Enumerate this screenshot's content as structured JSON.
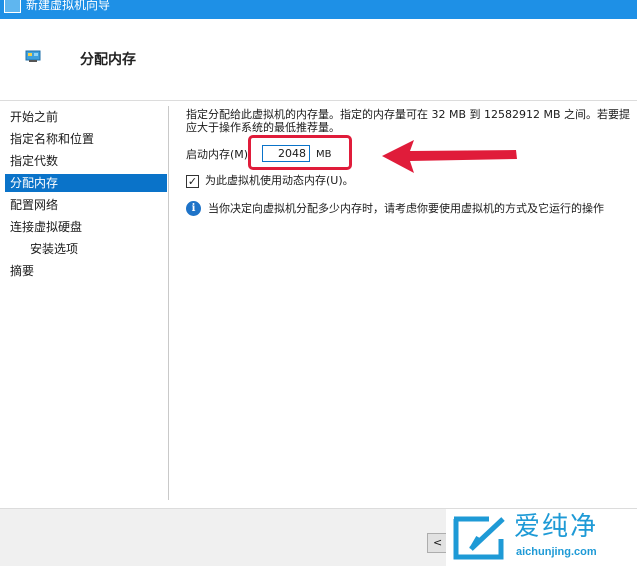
{
  "window": {
    "title": "新建虚拟机向导"
  },
  "header": {
    "title": "分配内存",
    "icon": "memory-chip-icon"
  },
  "nav": {
    "items": [
      {
        "label": "开始之前",
        "active": false
      },
      {
        "label": "指定名称和位置",
        "active": false
      },
      {
        "label": "指定代数",
        "active": false
      },
      {
        "label": "分配内存",
        "active": true
      },
      {
        "label": "配置网络",
        "active": false
      },
      {
        "label": "连接虚拟硬盘",
        "active": false
      },
      {
        "label": "安装选项",
        "active": false,
        "sub": true
      },
      {
        "label": "摘要",
        "active": false
      }
    ]
  },
  "main": {
    "description_line1": "指定分配给此虚拟机的内存量。指定的内存量可在 32 MB 到 12582912 MB 之间。若要提",
    "description_line2": "应大于操作系统的最低推荐量。",
    "startup_memory_label": "启动内存(M):",
    "startup_memory_value": "2048",
    "startup_memory_unit": "MB",
    "dynamic_memory_label": "为此虚拟机使用动态内存(U)。",
    "dynamic_memory_checked": true,
    "info_text": "当你决定向虚拟机分配多少内存时，请考虑你要使用虚拟机的方式及它运行的操作"
  },
  "footer": {
    "prev_button_label": "<"
  },
  "watermark": {
    "title": "爱纯净",
    "url": "aichunjing.com"
  },
  "colors": {
    "titlebar": "#1e90e6",
    "nav_active": "#0a73c9",
    "highlight": "#e01c3a",
    "watermark": "#1e9ad6"
  }
}
